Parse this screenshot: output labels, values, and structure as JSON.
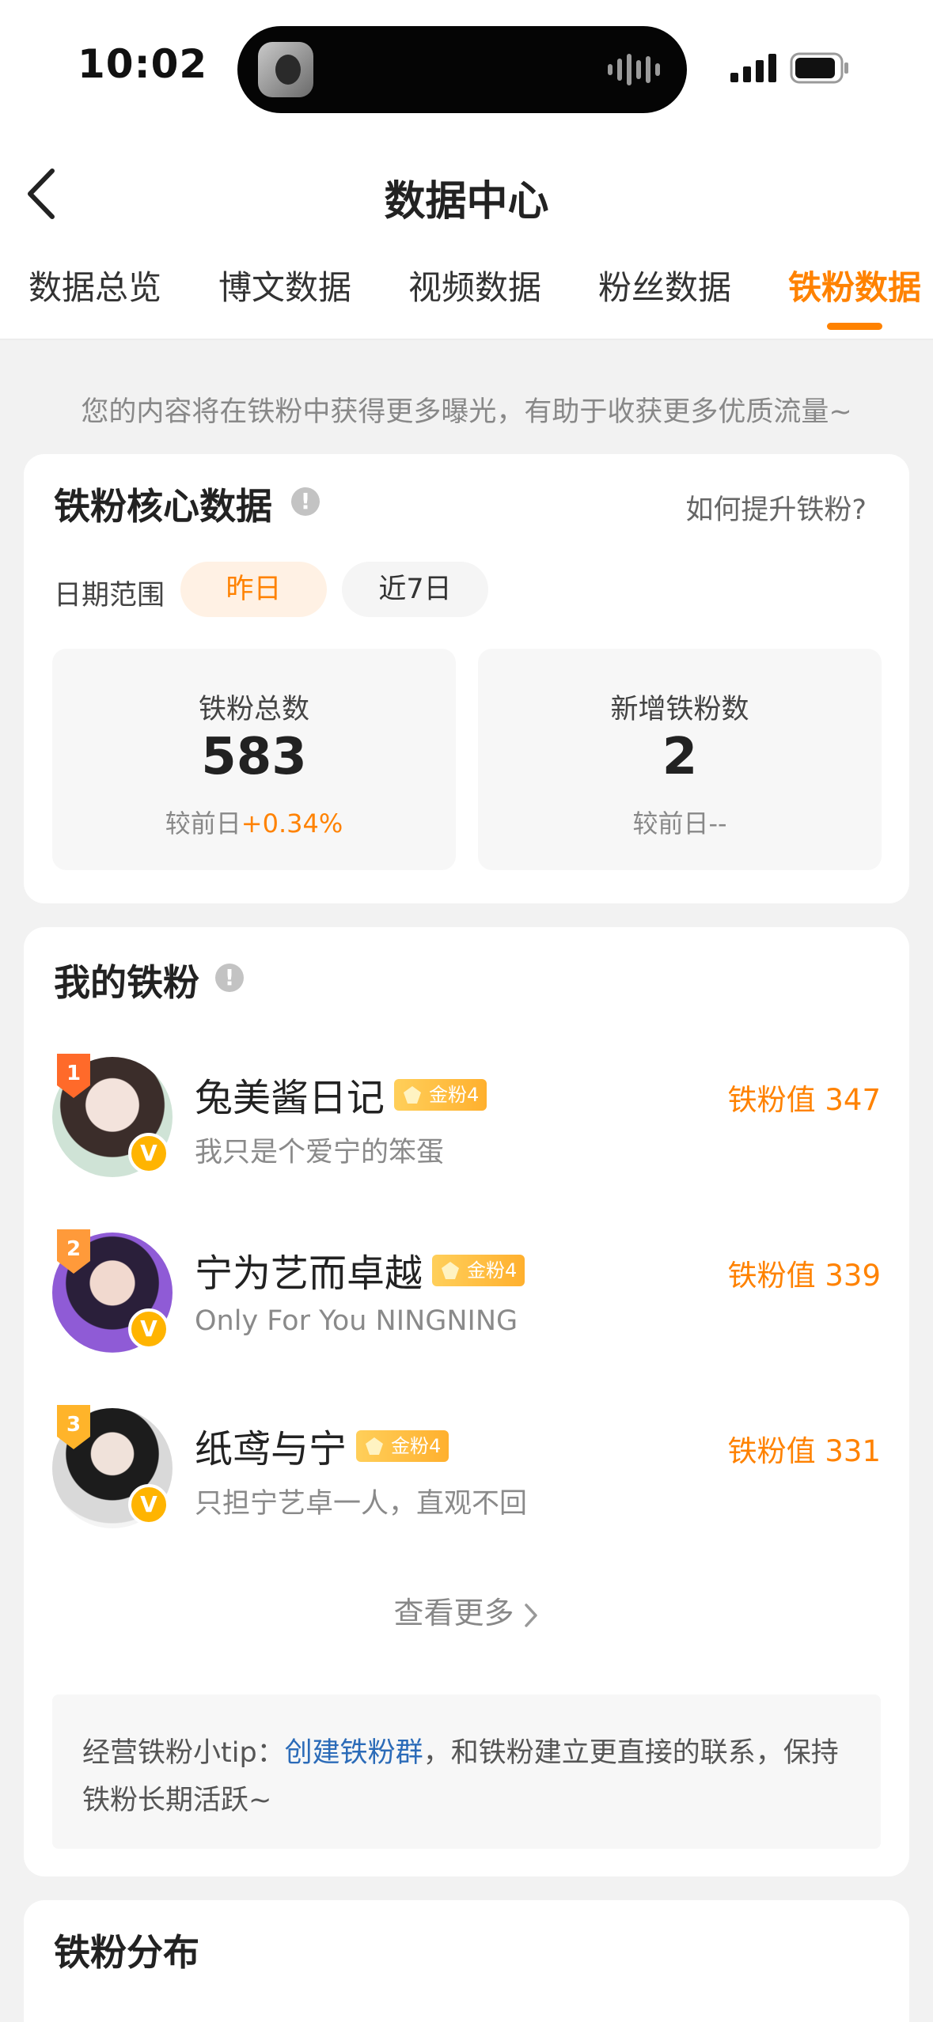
{
  "status": {
    "time": "10:02"
  },
  "nav": {
    "title": "数据中心",
    "tabs": [
      {
        "label": "数据总览",
        "active": false
      },
      {
        "label": "博文数据",
        "active": false
      },
      {
        "label": "视频数据",
        "active": false
      },
      {
        "label": "粉丝数据",
        "active": false
      },
      {
        "label": "铁粉数据",
        "active": true
      }
    ]
  },
  "hint": "您的内容将在铁粉中获得更多曝光，有助于收获更多优质流量~",
  "core": {
    "title": "铁粉核心数据",
    "how_link": "如何提升铁粉?",
    "date_label": "日期范围",
    "date_options": [
      {
        "label": "昨日",
        "active": true
      },
      {
        "label": "近7日",
        "active": false
      }
    ],
    "stats": [
      {
        "label": "铁粉总数",
        "value": "583",
        "compare_prefix": "较前日",
        "compare_value": "+0.34%"
      },
      {
        "label": "新增铁粉数",
        "value": "2",
        "compare_prefix": "较前日",
        "compare_value": "--"
      }
    ]
  },
  "my_fans": {
    "title": "我的铁粉",
    "items": [
      {
        "rank": "1",
        "name": "兔美酱日记",
        "level": "金粉4",
        "bio": "我只是个爱宁的笨蛋",
        "value_label": "铁粉值",
        "value": "347"
      },
      {
        "rank": "2",
        "name": "宁为艺而卓越",
        "level": "金粉4",
        "bio": "Only For You NINGNING",
        "value_label": "铁粉值",
        "value": "339"
      },
      {
        "rank": "3",
        "name": "纸鸢与宁",
        "level": "金粉4",
        "bio": "只担宁艺卓一人，直观不回",
        "value_label": "铁粉值",
        "value": "331"
      }
    ],
    "more_label": "查看更多",
    "tip_prefix": "经营铁粉小tip：",
    "tip_link": "创建铁粉群",
    "tip_suffix": "，和铁粉建立更直接的联系，保持铁粉长期活跃~"
  },
  "distribution": {
    "title": "铁粉分布"
  },
  "colors": {
    "accent": "#ff8200",
    "link": "#2b6bb8",
    "gold": "#ffb400"
  }
}
